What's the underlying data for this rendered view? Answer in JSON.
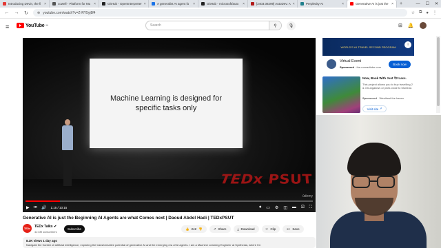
{
  "browser": {
    "tabs": [
      {
        "label": "Introducing Devin, the fi",
        "color": "#e53935"
      },
      {
        "label": "cowell - Platform for Mu",
        "color": "#555555"
      },
      {
        "label": "GitHub - OpenInterpreter",
        "color": "#222222"
      },
      {
        "label": "A generalist AI agent fo",
        "color": "#1a73e8"
      },
      {
        "label": "GitHub - microsoft/auto",
        "color": "#222222"
      },
      {
        "label": "[2403.08299] AutoDev: A",
        "color": "#b31b1b"
      },
      {
        "label": "Perplexity AI",
        "color": "#20808d"
      },
      {
        "label": "Generative AI is just the",
        "color": "#ff0000"
      }
    ],
    "active_tab_index": 7,
    "url": "youtube.com/watch?v=Z-RY5yj8f4"
  },
  "youtube": {
    "logo_text": "YouTube",
    "logo_sup": "IN",
    "search_placeholder": "Search"
  },
  "player": {
    "slide_text": "Machine Learning is designed for specific tasks only",
    "watermark": "TEDx PSUT",
    "time": "1:15 / 10:15",
    "progress": 0.12,
    "udemy": "ūdemy"
  },
  "ads": {
    "banner_text": "WORLD'S #1 TRAVEL SECOND PROGRAM",
    "virtual_event": {
      "title": "Virtual Event",
      "sponsored": "Sponsored",
      "domain": "· the-nomadtobe.com",
      "button": "Book now"
    },
    "promo": {
      "title": "Now, Book With Just ₹2 Lacs.",
      "description": "This project allows you to buy travelling 2 & 3 bungalows or plots close to Mumbai.",
      "sponsored": "Sponsored",
      "advertiser": "· Weathest the haven",
      "button": "Visit site"
    }
  },
  "video": {
    "title": "Generative AI is just the Beginning AI Agents are what Comes next | Daoud Abdel Hadi | TEDxPSUT",
    "channel": "TEDx Talks",
    "channel_logo": "TEDx",
    "subscribers": "42.6M subscribers",
    "subscribe_label": "Subscribe",
    "likes": "242",
    "share": "Share",
    "download": "Download",
    "clip": "Clip",
    "save": "Save",
    "views_date": "8.3K views  1 day ago",
    "description": "Navigate the frontier of artificial intelligence, exploring the transformative potential of generative AI and the emerging era of AI agents. I am a Machine Learning Engineer at Synthesia, where I'm"
  }
}
